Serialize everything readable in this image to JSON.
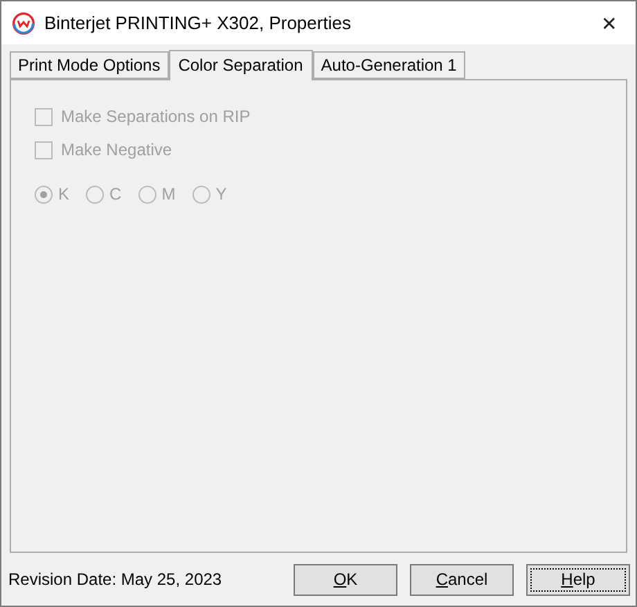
{
  "window": {
    "title": "Binterjet PRINTING+ X302, Properties",
    "close": "✕"
  },
  "tabs": [
    {
      "label": "Print Mode Options",
      "selected": false
    },
    {
      "label": "Color Separation",
      "selected": true
    },
    {
      "label": "Auto-Generation 1",
      "selected": false
    }
  ],
  "checkboxes": [
    {
      "label": "Make Separations on RIP",
      "checked": false,
      "disabled": true
    },
    {
      "label": "Make Negative",
      "checked": false,
      "disabled": true
    }
  ],
  "radios": [
    {
      "label": "K",
      "selected": true,
      "disabled": true
    },
    {
      "label": "C",
      "selected": false,
      "disabled": true
    },
    {
      "label": "M",
      "selected": false,
      "disabled": true
    },
    {
      "label": "Y",
      "selected": false,
      "disabled": true
    }
  ],
  "revision": "Revision Date: May 25, 2023",
  "buttons": [
    {
      "label": "OK",
      "underline_first": true,
      "focused": false
    },
    {
      "label": "Cancel",
      "underline_first": true,
      "focused": false
    },
    {
      "label": "Help",
      "underline_first": true,
      "focused": true
    }
  ]
}
